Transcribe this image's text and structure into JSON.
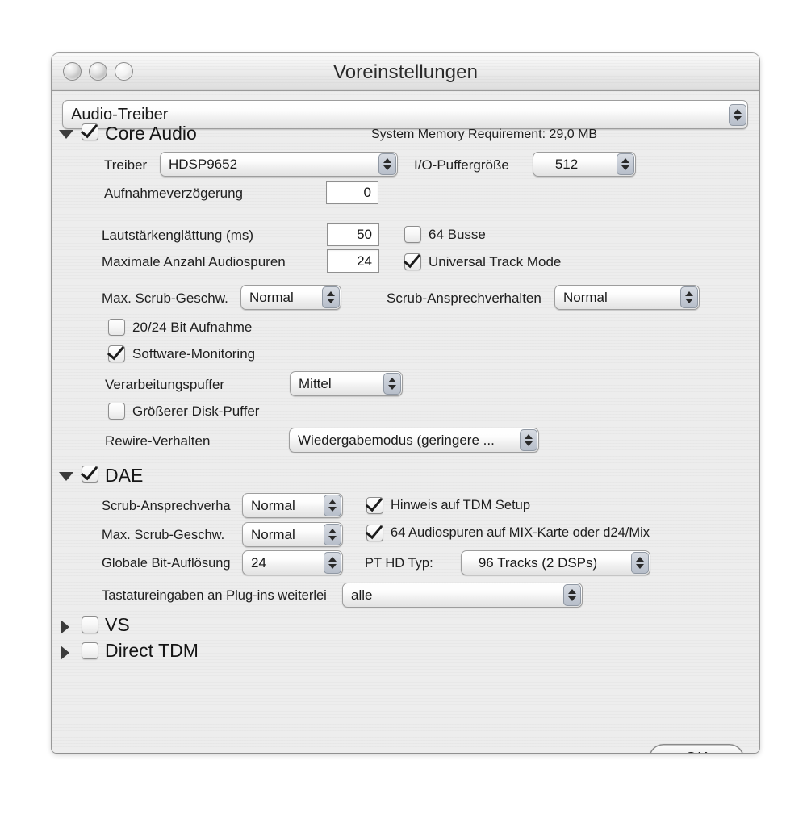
{
  "window": {
    "title": "Voreinstellungen",
    "traffic_lights": [
      "close-button",
      "minimize-button",
      "zoom-button"
    ]
  },
  "page_selector": {
    "value": "Audio-Treiber"
  },
  "core_audio": {
    "title": "Core Audio",
    "expanded": true,
    "checked": true,
    "memory_note": "System Memory Requirement: 29,0 MB",
    "driver_label": "Treiber",
    "driver_value": "HDSP9652",
    "io_buffer_label": "I/O-Puffergröße",
    "io_buffer_value": "512",
    "record_delay_label": "Aufnahmeverzögerung",
    "record_delay_value": "0",
    "volume_smoothing_label": "Lautstärkenglättung (ms)",
    "volume_smoothing_value": "50",
    "max_tracks_label": "Maximale Anzahl Audiospuren",
    "max_tracks_value": "24",
    "busses_label": "64 Busse",
    "busses_checked": false,
    "universal_track_label": "Universal Track Mode",
    "universal_track_checked": true,
    "max_scrub_label": "Max. Scrub-Geschw.",
    "max_scrub_value": "Normal",
    "scrub_response_label": "Scrub-Ansprechverhalten",
    "scrub_response_value": "Normal",
    "bit_record_label": "20/24 Bit Aufnahme",
    "bit_record_checked": false,
    "software_monitoring_label": "Software-Monitoring",
    "software_monitoring_checked": true,
    "process_buffer_label": "Verarbeitungspuffer",
    "process_buffer_value": "Mittel",
    "larger_disk_buffer_label": "Größerer Disk-Puffer",
    "larger_disk_buffer_checked": false,
    "rewire_label": "Rewire-Verhalten",
    "rewire_value": "Wiedergabemodus (geringere ..."
  },
  "dae": {
    "title": "DAE",
    "expanded": true,
    "checked": true,
    "scrub_response_label": "Scrub-Ansprechverha",
    "scrub_response_value": "Normal",
    "max_scrub_label": "Max. Scrub-Geschw.",
    "max_scrub_value": "Normal",
    "tdm_hint_label": "Hinweis auf TDM Setup",
    "tdm_hint_checked": true,
    "mix_tracks_label": "64 Audiospuren auf MIX-Karte oder d24/Mix",
    "mix_tracks_checked": true,
    "bit_depth_label": "Globale Bit-Auflösung",
    "bit_depth_value": "24",
    "pt_hd_label": "PT HD Typ:",
    "pt_hd_value": "96 Tracks (2 DSPs)",
    "keyboard_label": "Tastatureingaben an Plug-ins weiterlei",
    "keyboard_value": "alle"
  },
  "vs": {
    "title": "VS",
    "expanded": false,
    "checked": false
  },
  "direct_tdm": {
    "title": "Direct TDM",
    "expanded": false,
    "checked": false
  },
  "footer": {
    "ok_label": "OK"
  }
}
